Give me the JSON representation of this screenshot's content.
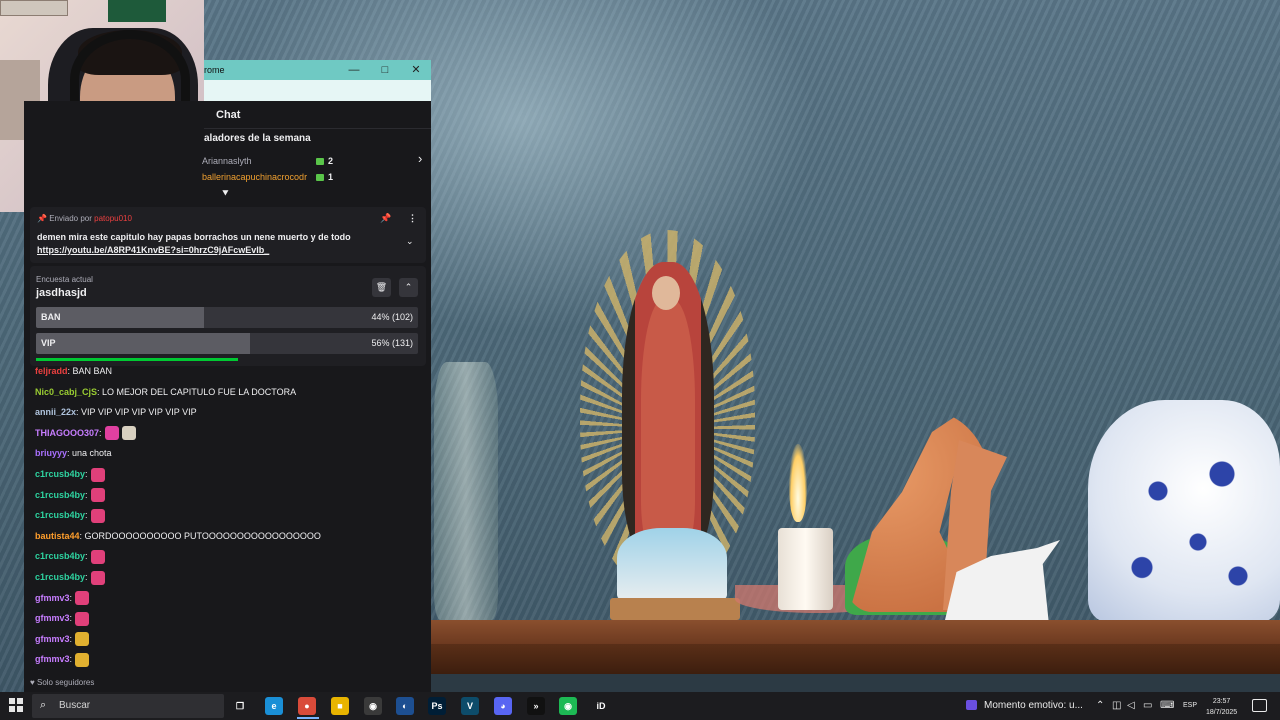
{
  "window": {
    "title": "rome",
    "minimize": "—",
    "maximize": "□",
    "close": "✕"
  },
  "chat": {
    "header": "Chat",
    "gifters_title": "aladores de la semana",
    "gifters": [
      {
        "name": "Ariannaslyth",
        "count": "2",
        "color": "#adadb8"
      },
      {
        "name": "ballerinacapuchinacrocodr",
        "count": "1",
        "color": "#f0a030"
      }
    ],
    "pinned": {
      "label": "Enviado por",
      "author": "patopu010",
      "message": "demen mira este capitulo hay papas borrachos un nene muerto y de todo",
      "link": "https://youtu.be/A8RP41KnvBE?si=0hrzC9jAFcwEvlb_"
    },
    "poll": {
      "label": "Encuesta actual",
      "question": "jasdhasjd",
      "options": [
        {
          "name": "BAN",
          "result": "44% (102)",
          "fraction": 0.44
        },
        {
          "name": "VIP",
          "result": "56% (131)",
          "fraction": 0.56
        }
      ],
      "time_remaining_fraction": 0.53
    },
    "messages": [
      {
        "user": "feljradd",
        "text": ": BAN BAN",
        "color": "#eb4040",
        "emotes": []
      },
      {
        "user": "Nic0_cabj_CjS",
        "text": ": LO MEJOR DEL CAPITULO FUE LA DOCTORA",
        "color": "#9acd32",
        "emotes": []
      },
      {
        "user": "annii_22x",
        "text": ": VIP VIP VIP VIP VIP VIP VIP",
        "color": "#b0c4de",
        "emotes": []
      },
      {
        "user": "THIAGOOO307",
        "text": ":",
        "color": "#c77dff",
        "emotes": [
          "#e040a0",
          "#d8d0c0"
        ]
      },
      {
        "user": "briuyyy",
        "text": ": una chota",
        "color": "#a970ff",
        "emotes": []
      },
      {
        "user": "c1rcusb4by",
        "text": ":",
        "color": "#2ed3a0",
        "emotes": [
          "#e0407a"
        ]
      },
      {
        "user": "c1rcusb4by",
        "text": ":",
        "color": "#2ed3a0",
        "emotes": [
          "#e0407a"
        ]
      },
      {
        "user": "c1rcusb4by",
        "text": ":",
        "color": "#2ed3a0",
        "emotes": [
          "#e0407a"
        ]
      },
      {
        "user": "bautista44",
        "text": ": GORDOOOOOOOOOO PUTOOOOOOOOOOOOOOOOO",
        "color": "#ff9e2c",
        "emotes": []
      },
      {
        "user": "c1rcusb4by",
        "text": ":",
        "color": "#2ed3a0",
        "emotes": [
          "#e0407a"
        ]
      },
      {
        "user": "c1rcusb4by",
        "text": ":",
        "color": "#2ed3a0",
        "emotes": [
          "#e0407a"
        ]
      },
      {
        "user": "gfmmv3",
        "text": ":",
        "color": "#c77dff",
        "emotes": [
          "#e0407a"
        ]
      },
      {
        "user": "gfmmv3",
        "text": ":",
        "color": "#c77dff",
        "emotes": [
          "#e0407a"
        ]
      },
      {
        "user": "gfmmv3",
        "text": ":",
        "color": "#c77dff",
        "emotes": [
          "#e0b030"
        ]
      },
      {
        "user": "gfmmv3",
        "text": ":",
        "color": "#c77dff",
        "emotes": [
          "#e0b030"
        ]
      }
    ],
    "followers_only": "Solo seguidores"
  },
  "taskbar": {
    "search_placeholder": "Buscar",
    "apps": [
      {
        "name": "task-view-icon",
        "label": "❐",
        "color": "#1c1c1f"
      },
      {
        "name": "edge-icon",
        "label": "e",
        "color": "#1a8fd6"
      },
      {
        "name": "chrome-icon",
        "label": "●",
        "color": "#d94b3a"
      },
      {
        "name": "file-explorer-icon",
        "label": "■",
        "color": "#e8b400"
      },
      {
        "name": "obs-icon",
        "label": "◉",
        "color": "#3a3a3a"
      },
      {
        "name": "steam-icon",
        "label": "◐",
        "color": "#1d4f91"
      },
      {
        "name": "photoshop-icon",
        "label": "Ps",
        "color": "#001e36"
      },
      {
        "name": "vegas-icon",
        "label": "V",
        "color": "#0d4c6a"
      },
      {
        "name": "discord-icon",
        "label": "◕",
        "color": "#5865f2"
      },
      {
        "name": "capcut-icon",
        "label": "»",
        "color": "#111111"
      },
      {
        "name": "spotify-icon",
        "label": "◉",
        "color": "#1db954"
      },
      {
        "name": "id-icon",
        "label": "iD",
        "color": "#1c1c1f"
      }
    ],
    "media": "Momento emotivo: u...",
    "language": "ESP",
    "time": "23:57",
    "date": "18/7/2025"
  }
}
